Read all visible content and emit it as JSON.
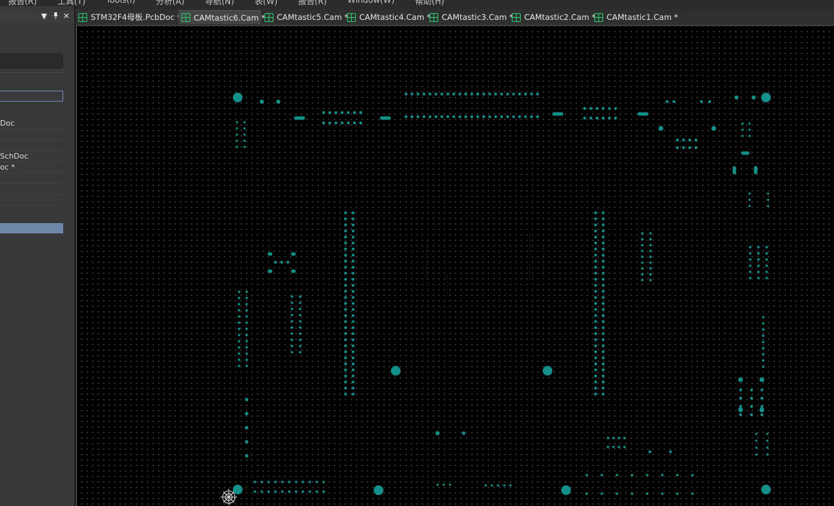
{
  "menu": {
    "items": [
      "报告(R)",
      "工具(T)",
      "Tools(I)",
      "分析(A)",
      "导航(N)",
      "表(W)",
      "报告(R)",
      "Window(W)",
      "帮助(H)"
    ]
  },
  "panel": {
    "files": [
      {
        "label": "Doc",
        "selected": false
      },
      {
        "label": "",
        "selected": false
      },
      {
        "label": "",
        "selected": false
      },
      {
        "label": "SchDoc",
        "selected": false
      },
      {
        "label": "oc *",
        "selected": false
      },
      {
        "label": "",
        "selected": false
      },
      {
        "label": "",
        "selected": false
      },
      {
        "label": "",
        "selected": false
      },
      {
        "label": "",
        "selected": true
      }
    ],
    "controls": {
      "dropdown": "▼",
      "pin": "🖈",
      "close": "✕"
    }
  },
  "tabs": [
    {
      "label": "STM32F4母板.PcbDoc *",
      "active": false,
      "icon": "pcb-doc-icon"
    },
    {
      "label": "CAMtastic6.Cam *",
      "active": true,
      "icon": "cam-doc-icon"
    },
    {
      "label": "CAMtastic5.Cam *",
      "active": false,
      "icon": "cam-doc-icon"
    },
    {
      "label": "CAMtastic4.Cam *",
      "active": false,
      "icon": "cam-doc-icon"
    },
    {
      "label": "CAMtastic3.Cam *",
      "active": false,
      "icon": "cam-doc-icon"
    },
    {
      "label": "CAMtastic2.Cam *",
      "active": false,
      "icon": "cam-doc-icon"
    },
    {
      "label": "CAMtastic1.Cam *",
      "active": false,
      "icon": "cam-doc-icon"
    }
  ],
  "colors": {
    "pad": "#13908a",
    "pcb_icon": "#2dbf6a",
    "canvas_bg": "#000000",
    "selection": "#6e86a8"
  }
}
